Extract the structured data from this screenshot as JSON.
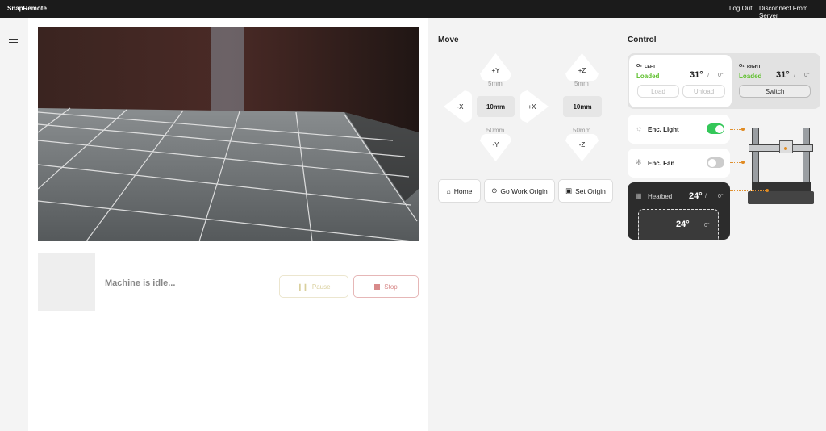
{
  "topbar": {
    "brand": "SnapRemote",
    "logout": "Log Out",
    "disconnect": "Disconnect From Server"
  },
  "status": {
    "message": "Machine is idle...",
    "pause": "Pause",
    "stop": "Stop"
  },
  "move": {
    "title": "Move",
    "plus_y": "+Y",
    "minus_y": "-Y",
    "plus_x": "+X",
    "minus_x": "-X",
    "plus_z": "+Z",
    "minus_z": "-Z",
    "xy_small": "5mm",
    "xy_step": "10mm",
    "xy_large": "50mm",
    "z_small": "5mm",
    "z_step": "10mm",
    "z_large": "50mm",
    "home": "Home",
    "go_work_origin": "Go Work Origin",
    "set_origin": "Set Origin"
  },
  "control": {
    "title": "Control",
    "left": {
      "label": "LEFT",
      "state": "Loaded",
      "temp": "31°",
      "slash": "/",
      "target": "0°",
      "load": "Load",
      "unload": "Unload"
    },
    "right": {
      "label": "RIGHT",
      "state": "Loaded",
      "temp": "31°",
      "slash": "/",
      "target": "0°",
      "switch": "Switch"
    },
    "light": {
      "label": "Enc. Light",
      "on": true
    },
    "fan": {
      "label": "Enc. Fan",
      "on": false
    },
    "heatbed": {
      "label": "Heatbed",
      "temp": "24°",
      "slash": "/",
      "target": "0°",
      "zone_temp": "24°",
      "zone_target": "0°"
    },
    "accent": "#e08a20",
    "loaded_color": "#5cbf2a"
  }
}
